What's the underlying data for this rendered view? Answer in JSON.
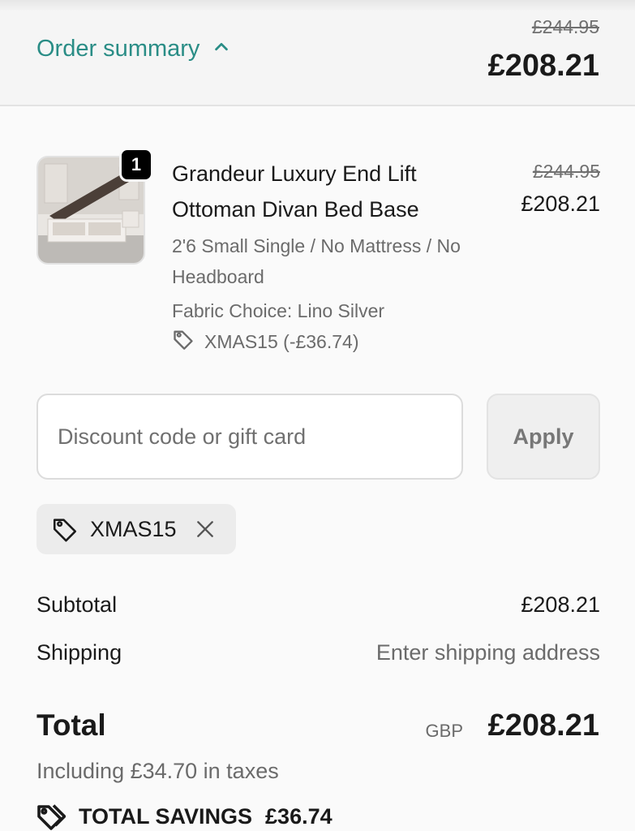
{
  "header": {
    "toggle_label": "Order summary",
    "original_price": "£244.95",
    "price": "£208.21"
  },
  "product": {
    "quantity": "1",
    "title": "Grandeur Luxury End Lift Ottoman Divan Bed Base",
    "variant": "2'6 Small Single / No Mattress / No Headboard",
    "fabric": "Fabric Choice: Lino Silver",
    "discount": "XMAS15 (-£36.74)",
    "original_price": "£244.95",
    "price": "£208.21",
    "image_icon": "bed-product-photo"
  },
  "discount": {
    "placeholder": "Discount code or gift card",
    "value": "",
    "apply_label": "Apply"
  },
  "applied_code": {
    "code": "XMAS15"
  },
  "totals": {
    "subtotal_label": "Subtotal",
    "subtotal_value": "£208.21",
    "shipping_label": "Shipping",
    "shipping_value": "Enter shipping address",
    "total_label": "Total",
    "currency": "GBP",
    "total_value": "£208.21",
    "taxes": "Including £34.70 in taxes",
    "savings_label": "TOTAL SAVINGS",
    "savings_value": "£36.74"
  },
  "colors": {
    "accent": "#2a8d86",
    "muted_text": "#6b6b6b"
  }
}
